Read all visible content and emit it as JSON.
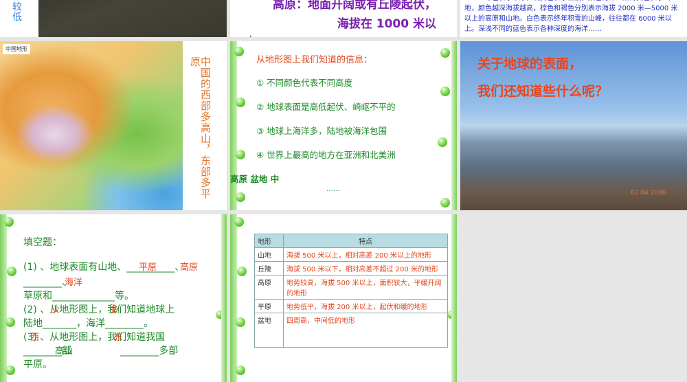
{
  "slides": [
    {
      "vertical_text": "较低"
    },
    {
      "line1": "高原：地面开阔或有丘陵起伏，",
      "line2": "海拔在 1000 米以",
      "line3": "上"
    },
    {
      "paragraph": "绿色表示平原，浅黄色表示丘陵，颜色再深一点的黄色表示山地，颜色越深海拔越高，棕色和褐色分别表示海拔 2000 米—5000 米以上的高原和山地。白色表示终年积雪的山峰，往往都在 6000 米以上。深浅不同的蓝色表示各种深度的海洋……"
    },
    {
      "map_title": "中国地形",
      "side_text": "中国的西部多高山，东部多平",
      "side_text2": "原"
    },
    {
      "heading": "从地形图上我们知道的信息：",
      "items": [
        "① 不同颜色代表不同高度",
        "② 地球表面是高低起伏、崎岖不平的",
        "③ 地球上海洋多，陆地被海洋包围",
        "④ 世界上最高的地方在亚洲和北美洲"
      ],
      "overlap": "高原 盆地 中",
      "ellipsis": "……"
    },
    {
      "title1": "关于地球的表面，",
      "title2": "我们还知道些什么呢？",
      "date": "02 04 2006"
    },
    {
      "heading": "填空题：",
      "q1a": "(1) 、地球表面有山地、__________、",
      "q1b": "________、",
      "q1c": "草原和_____________等。",
      "q2a": "(2) 、从地形图上，我们知道地球上",
      "q2b": "陆地_______，海洋________。",
      "q3a": "(3) 、从地形图上，我们知道我国",
      "q3b": "________部                ________多部",
      "q3c": "平原。",
      "answers": {
        "a1": "平原",
        "a2": "高原",
        "a3": "海洋",
        "a4": "少",
        "a5": "多",
        "a6": "西",
        "a7": "东",
        "a8": "高山"
      }
    },
    {
      "table": {
        "headers": [
          "地形",
          "特点"
        ],
        "rows": [
          [
            "山地",
            "海拔 500 米以上，相对高差 200 米以上的地形"
          ],
          [
            "丘陵",
            "海拔 500 米以下，相对高差不超过 200 米的地形"
          ],
          [
            "高原",
            "地势较高，海拔 500 米以上，面积较大，平缓开阔的地形"
          ],
          [
            "平原",
            "地势低平，海拔 200 米以上，起伏和缓的地形"
          ],
          [
            "盆地",
            "四周高，中间低的地形"
          ]
        ]
      }
    }
  ]
}
